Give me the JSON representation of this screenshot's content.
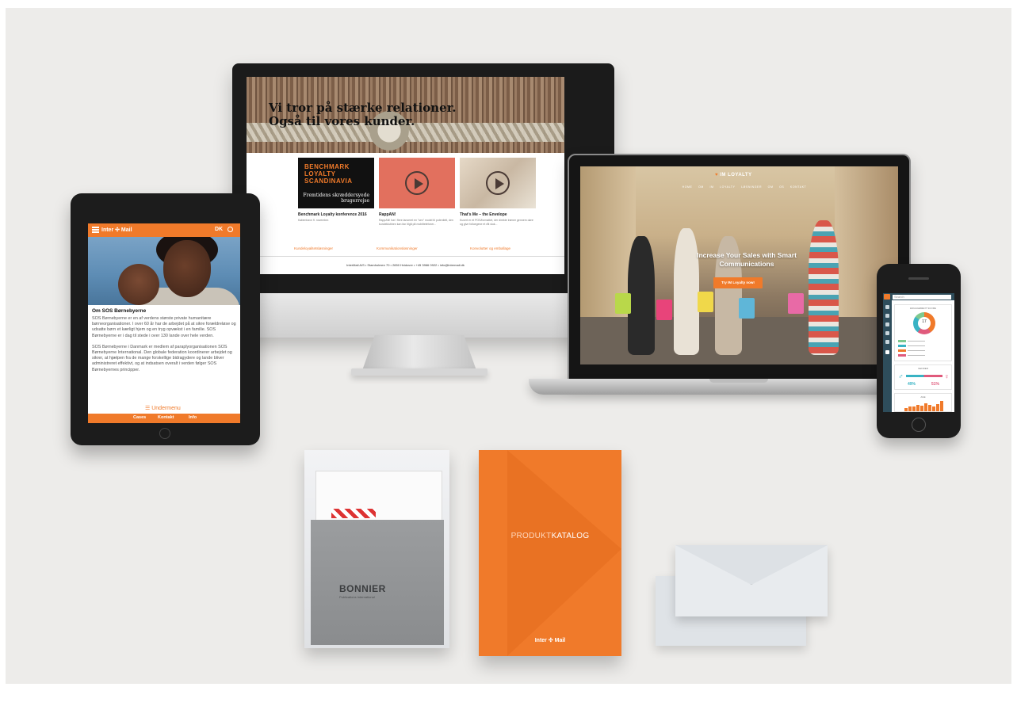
{
  "imac": {
    "hero_title": "Vi tror på stærke relationer. Også til vores kunder.",
    "cards": [
      {
        "title": "Benchmark Loyalty konference 2016",
        "text": "København 9. november."
      },
      {
        "title": "RappAN!",
        "text": "RappAN! har i flere lanceret en \"sex\" model til potentielt, den kundeklubben kan fan tilgå på mobiltelefoner..."
      },
      {
        "title": "That's Me – the Envelope",
        "text": "Kuvert er et POS/formattet, der direkte træner gennem døre og give folloegene et råt sluk..."
      }
    ],
    "benchmark_badge": "BENCHMARK LOYALTY SCANDINAVIA",
    "benchmark_sub": "Fremtidens skræddersyede brugerrejse",
    "links": [
      "Kundeloyalitetsløsninger",
      "Kommunikationsløsninger",
      "Konvolutter og emballage"
    ],
    "footer": "InterMail A/S  •  Stamholmen 70  •  2650 Hvidovre  •  +45 3966 0922  •  info@intermail.dk"
  },
  "tablet": {
    "brand": "Inter ✣ Mail",
    "lang": "DK",
    "heading": "Om SOS Børnebyerne",
    "para1": "SOS Børnebyerne er en af verdens største private humanitære børneorganisationer. I over 60 år har de arbejdet på at sikre forældreløse og udsatte børn et kærligt hjem og en tryg opvækst i en familie. SOS Børnebyerne er i dag til stede i over 130 lande over hele verden.",
    "para2": "SOS Børnebyerne i Danmark er medlem af paraplyorganisationen SOS Børnebyerne International. Den globale federation koordinerer arbejdet og sikrer, at hjælpen fra de mange forskellige bidragydere og lande bliver administreret effektivt, og at indsatsen overalt i verden følger SOS Børnebyernes principper.",
    "undermenu": "Undermenu",
    "footer_items": [
      "Cases",
      "Kontakt",
      "Info"
    ]
  },
  "laptop": {
    "logo": "IM LOYALTY",
    "nav": "HOME  OM IM LOYALTY  LØSNINGER  OM OS  KONTAKT",
    "headline": "Increase Your Sales with Smart Communications",
    "cta": "Try IM Loyalty now!"
  },
  "phone": {
    "search_placeholder": "Search",
    "panel1_title": "ENGAGEMENT SCORE",
    "score": "17",
    "panel2_title": "GENDER",
    "male_pct": "49%",
    "female_pct": "51%",
    "panel3_title": "AGE",
    "age_values": [
      0.3,
      0.45,
      0.4,
      0.6,
      0.5,
      0.7,
      0.55,
      0.4,
      0.65,
      0.9
    ]
  },
  "print": {
    "bag_brand": "BONNIER",
    "bag_tag": "Publications International",
    "catalog_title_a": "PRODUKT",
    "catalog_title_b": "KATALOG",
    "catalog_logo": "Inter ✣ Mail"
  },
  "colors": {
    "brand_orange": "#f07a2a",
    "dashboard_navy": "#2e4d5b",
    "backdrop": "#edecea"
  }
}
